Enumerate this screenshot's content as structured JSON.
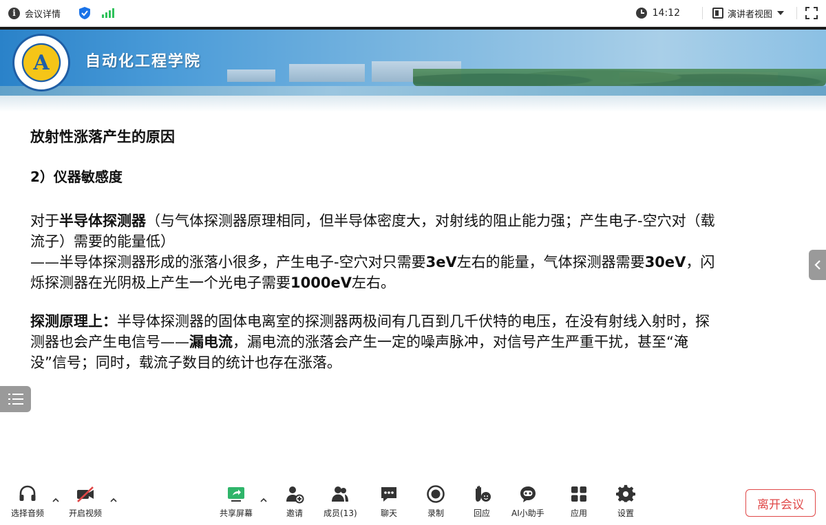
{
  "topbar": {
    "meeting_info_label": "会议详情",
    "time": "14:12",
    "view_label": "演讲者视图"
  },
  "slide": {
    "school_title": "自动化工程学院",
    "title": "放射性涨落产生的原因",
    "subtitle": "2）仪器敏感度",
    "para1": {
      "t1": "对于",
      "t2": "半导体探测器",
      "t3": "（与气体探测器原理相同，但半导体密度大，对射线的阻止能力强；产生电子-空穴对（载流子）需要的能量低）",
      "t4": "——半导体探测器形成的涨落小很多，产生电子-空穴对只需要",
      "t5": "3eV",
      "t6": "左右的能量，气体探测器需要",
      "t7": "30eV",
      "t8": "，闪烁探测器在光阴极上产生一个光电子需要",
      "t9": "1000eV",
      "t10": "左右。"
    },
    "para2": {
      "t1": "探测原理上：",
      "t2": "半导体探测器的固体电离室的探测器两极间有几百到几千伏特的电压，在没有射线入射时，探测器也会产生电信号——",
      "t3": "漏电流",
      "t4": "，漏电流的涨落会产生一定的噪声脉冲，对信号产生严重干扰，甚至“淹没”信号；同时，载流子数目的统计也存在涨落。"
    }
  },
  "toolbar": {
    "audio": "选择音频",
    "video": "开启视频",
    "share": "共享屏幕",
    "invite": "邀请",
    "members": "成员(13)",
    "chat": "聊天",
    "record": "录制",
    "react": "回应",
    "ai": "AI小助手",
    "apps": "应用",
    "settings": "设置",
    "leave": "离开会议"
  },
  "colors": {
    "leave_red": "#e04848",
    "signal_green": "#2fc25b",
    "shield_blue": "#1a73e8",
    "share_green": "#2fb56a"
  }
}
